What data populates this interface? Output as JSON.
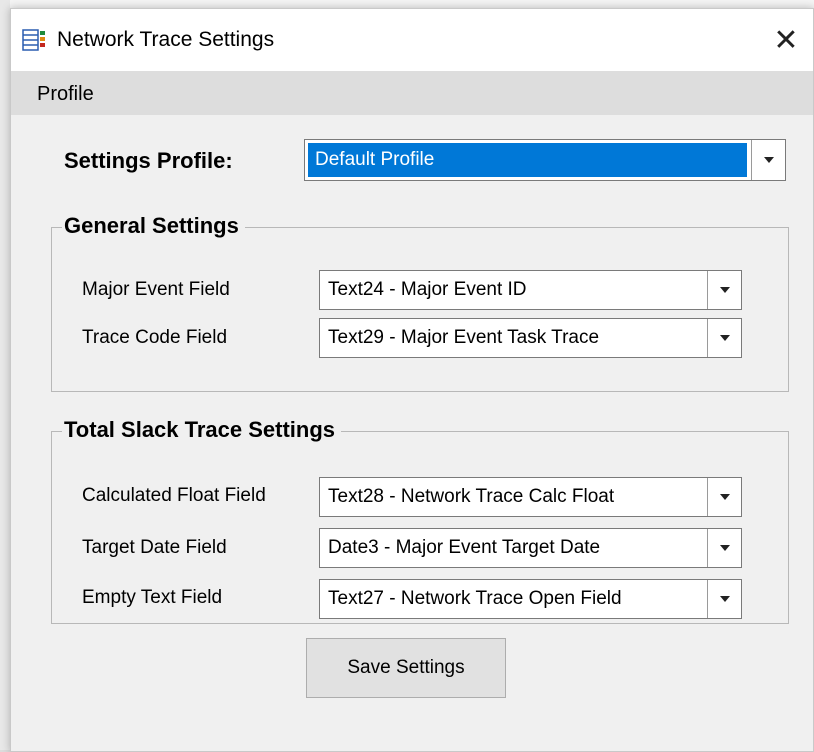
{
  "window": {
    "title": "Network Trace Settings",
    "close_glyph": "✕"
  },
  "menu": {
    "items": [
      "Profile"
    ]
  },
  "profile": {
    "label": "Settings Profile:",
    "value": "Default Profile"
  },
  "general": {
    "title": "General Settings",
    "fields": [
      {
        "label": "Major Event Field",
        "value": "Text24 - Major Event ID"
      },
      {
        "label": "Trace Code Field",
        "value": "Text29 - Major Event Task Trace"
      }
    ]
  },
  "slack": {
    "title": "Total Slack Trace Settings",
    "fields": [
      {
        "label": "Calculated Float Field",
        "value": "Text28 - Network Trace Calc Float"
      },
      {
        "label": "Target Date Field",
        "value": "Date3 - Major Event Target Date"
      },
      {
        "label": "Empty Text Field",
        "value": "Text27 - Network Trace Open Field"
      }
    ]
  },
  "actions": {
    "save_label": "Save Settings"
  },
  "colors": {
    "selection": "#0078d7",
    "menubar": "#dddddd",
    "window_bg": "#f0f0f0"
  }
}
